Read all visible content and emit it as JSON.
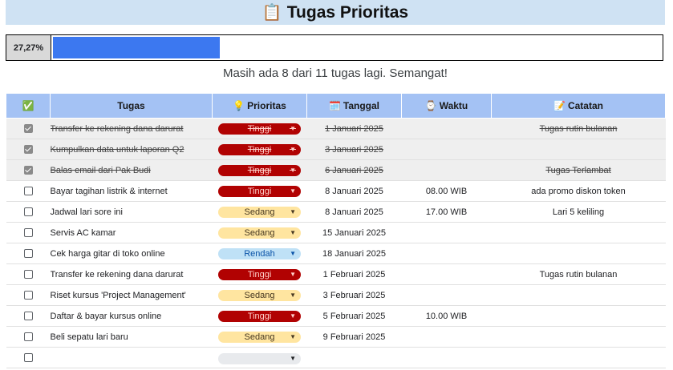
{
  "header": {
    "title": "Tugas Prioritas",
    "icon": "clipboard-icon"
  },
  "progress": {
    "label": "27,27%",
    "fraction": 0.2727
  },
  "message": "Masih ada 8 dari 11 tugas lagi. Semangat!",
  "columns": {
    "check": "✅",
    "task": "Tugas",
    "priority": "Prioritas",
    "date": "Tanggal",
    "time": "Waktu",
    "notes": "Catatan"
  },
  "column_icons": {
    "priority": "💡",
    "date": "🗓️",
    "time": "⌚",
    "notes": "📝"
  },
  "priority_colors": {
    "Tinggi": {
      "bg": "#b10202",
      "fg": "#ffcfc9"
    },
    "Sedang": {
      "bg": "#ffe5a0",
      "fg": "#473821"
    },
    "Rendah": {
      "bg": "#bfe1f6",
      "fg": "#0a53a8"
    },
    "": {
      "bg": "#e8eaed",
      "fg": "#202124"
    }
  },
  "rows": [
    {
      "done": true,
      "task": "Transfer ke rekening dana darurat",
      "priority": "Tinggi",
      "date": "1 Januari 2025",
      "time": "",
      "notes": "Tugas rutin bulanan"
    },
    {
      "done": true,
      "task": "Kumpulkan data untuk laporan Q2",
      "priority": "Tinggi",
      "date": "3 Januari 2025",
      "time": "",
      "notes": ""
    },
    {
      "done": true,
      "task": "Balas email dari Pak Budi",
      "priority": "Tinggi",
      "date": "6 Januari 2025",
      "time": "",
      "notes": "Tugas Terlambat"
    },
    {
      "done": false,
      "task": "Bayar tagihan listrik & internet",
      "priority": "Tinggi",
      "date": "8 Januari 2025",
      "time": "08.00 WIB",
      "notes": "ada promo diskon token"
    },
    {
      "done": false,
      "task": "Jadwal lari sore ini",
      "priority": "Sedang",
      "date": "8 Januari 2025",
      "time": "17.00 WIB",
      "notes": "Lari 5 keliling"
    },
    {
      "done": false,
      "task": "Servis AC kamar",
      "priority": "Sedang",
      "date": "15 Januari 2025",
      "time": "",
      "notes": ""
    },
    {
      "done": false,
      "task": "Cek harga gitar di toko online",
      "priority": "Rendah",
      "date": "18 Januari 2025",
      "time": "",
      "notes": ""
    },
    {
      "done": false,
      "task": "Transfer ke rekening dana darurat",
      "priority": "Tinggi",
      "date": "1 Februari 2025",
      "time": "",
      "notes": "Tugas rutin bulanan"
    },
    {
      "done": false,
      "task": "Riset kursus 'Project Management'",
      "priority": "Sedang",
      "date": "3 Februari 2025",
      "time": "",
      "notes": ""
    },
    {
      "done": false,
      "task": "Daftar & bayar kursus online",
      "priority": "Tinggi",
      "date": "5 Februari 2025",
      "time": "10.00 WIB",
      "notes": ""
    },
    {
      "done": false,
      "task": "Beli sepatu lari baru",
      "priority": "Sedang",
      "date": "9 Februari 2025",
      "time": "",
      "notes": ""
    },
    {
      "done": false,
      "task": "",
      "priority": "",
      "date": "",
      "time": "",
      "notes": ""
    }
  ]
}
